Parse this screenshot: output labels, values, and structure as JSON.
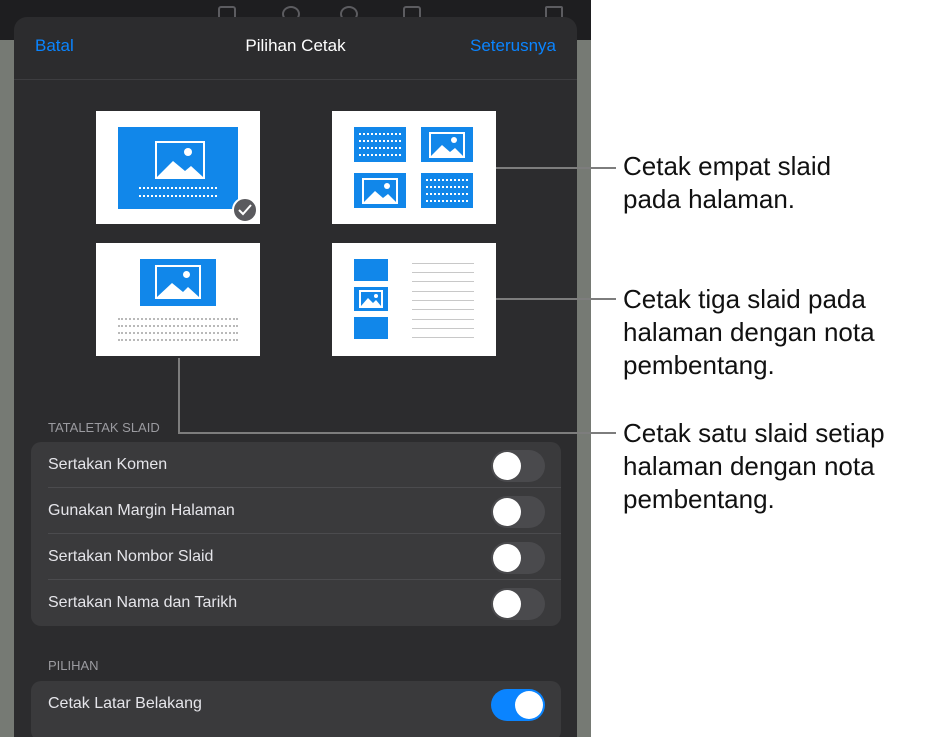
{
  "nav": {
    "cancel_label": "Batal",
    "title": "Pilihan Cetak",
    "next_label": "Seterusnya"
  },
  "layouts": [
    {
      "name": "one-slide",
      "selected": true
    },
    {
      "name": "four-slides",
      "selected": false
    },
    {
      "name": "one-slide-with-notes",
      "selected": false
    },
    {
      "name": "three-slides-with-notes",
      "selected": false
    }
  ],
  "slide_layout_section": {
    "header": "TATALETAK SLAID",
    "options": [
      {
        "label": "Sertakan Komen",
        "on": false
      },
      {
        "label": "Gunakan Margin Halaman",
        "on": false
      },
      {
        "label": "Sertakan Nombor Slaid",
        "on": false
      },
      {
        "label": "Sertakan Nama dan Tarikh",
        "on": false
      }
    ]
  },
  "options_section": {
    "header": "PILIHAN",
    "options": [
      {
        "label": "Cetak Latar Belakang",
        "on": true
      }
    ]
  },
  "callouts": {
    "four_slides": [
      "Cetak empat slaid",
      "pada halaman."
    ],
    "three_slides": [
      "Cetak tiga slaid pada",
      "halaman dengan nota",
      "pembentang."
    ],
    "one_slide_notes": [
      "Cetak satu slaid setiap",
      "halaman dengan nota",
      "pembentang."
    ]
  },
  "colors": {
    "accent": "#0a84ff",
    "thumbnail_blue": "#1187ea",
    "sheet_bg": "#2c2c2e",
    "group_bg": "#3a3a3c"
  }
}
